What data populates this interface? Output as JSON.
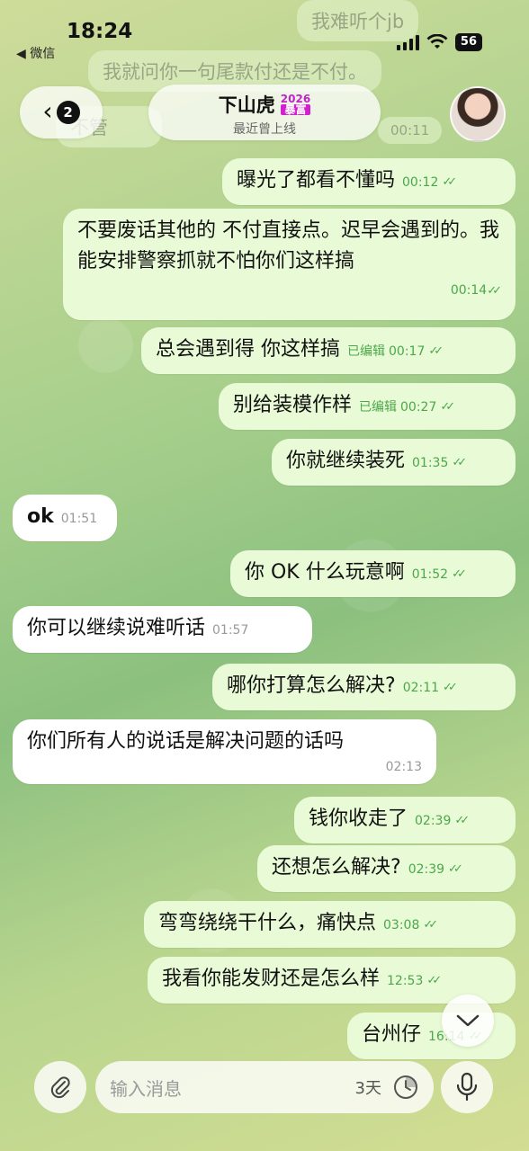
{
  "status_bar": {
    "time": "18:24",
    "back_app": "◀ 微信",
    "battery": "56"
  },
  "ghost_messages": [
    "我难听个jb",
    "我就问你一句尾款付还是不付。",
    "不管",
    "00:11"
  ],
  "header": {
    "unread_count": "2",
    "contact_name": "下山虎",
    "badge_year": "2026",
    "badge_word": "暴富",
    "last_seen": "最近曾上线"
  },
  "messages": [
    {
      "dir": "out",
      "text": "曝光了都看不懂吗",
      "time": "00:12",
      "edited": "",
      "ticks": true
    },
    {
      "dir": "out",
      "text": "不要废话其他的 不付直接点。迟早会遇到的。我能安排警察抓就不怕你们这样搞",
      "time": "00:14",
      "edited": "",
      "ticks": true
    },
    {
      "dir": "out",
      "text": "总会遇到得 你这样搞",
      "time": "00:17",
      "edited": "已编辑",
      "ticks": true
    },
    {
      "dir": "out",
      "text": "别给装模作样",
      "time": "00:27",
      "edited": "已编辑",
      "ticks": true
    },
    {
      "dir": "out",
      "text": "你就继续装死",
      "time": "01:35",
      "edited": "",
      "ticks": true
    },
    {
      "dir": "in",
      "text": "ok",
      "time": "01:51",
      "edited": "",
      "ticks": false
    },
    {
      "dir": "out",
      "text": "你 OK 什么玩意啊",
      "time": "01:52",
      "edited": "",
      "ticks": true
    },
    {
      "dir": "in",
      "text": "你可以继续说难听话",
      "time": "01:57",
      "edited": "",
      "ticks": false
    },
    {
      "dir": "out",
      "text": "哪你打算怎么解决?",
      "time": "02:11",
      "edited": "",
      "ticks": true
    },
    {
      "dir": "in",
      "text": "你们所有人的说话是解决问题的话吗",
      "time": "02:13",
      "edited": "",
      "ticks": false
    },
    {
      "dir": "out",
      "text": "钱你收走了",
      "time": "02:39",
      "edited": "",
      "ticks": true
    },
    {
      "dir": "out",
      "text": "还想怎么解决?",
      "time": "02:39",
      "edited": "",
      "ticks": true
    },
    {
      "dir": "out",
      "text": "弯弯绕绕干什么，痛快点",
      "time": "03:08",
      "edited": "",
      "ticks": true
    },
    {
      "dir": "out",
      "text": "我看你能发财还是怎么样",
      "time": "12:53",
      "edited": "",
      "ticks": true
    },
    {
      "dir": "out",
      "text": "台州仔",
      "time": "16:14",
      "edited": "",
      "ticks": true
    }
  ],
  "input_bar": {
    "placeholder": "输入消息",
    "timer": "3天"
  },
  "icons": {
    "back": "chevron-left-icon",
    "scroll": "chevron-down-icon",
    "attach": "paperclip-icon",
    "timer": "clock-icon",
    "mic": "microphone-icon"
  }
}
